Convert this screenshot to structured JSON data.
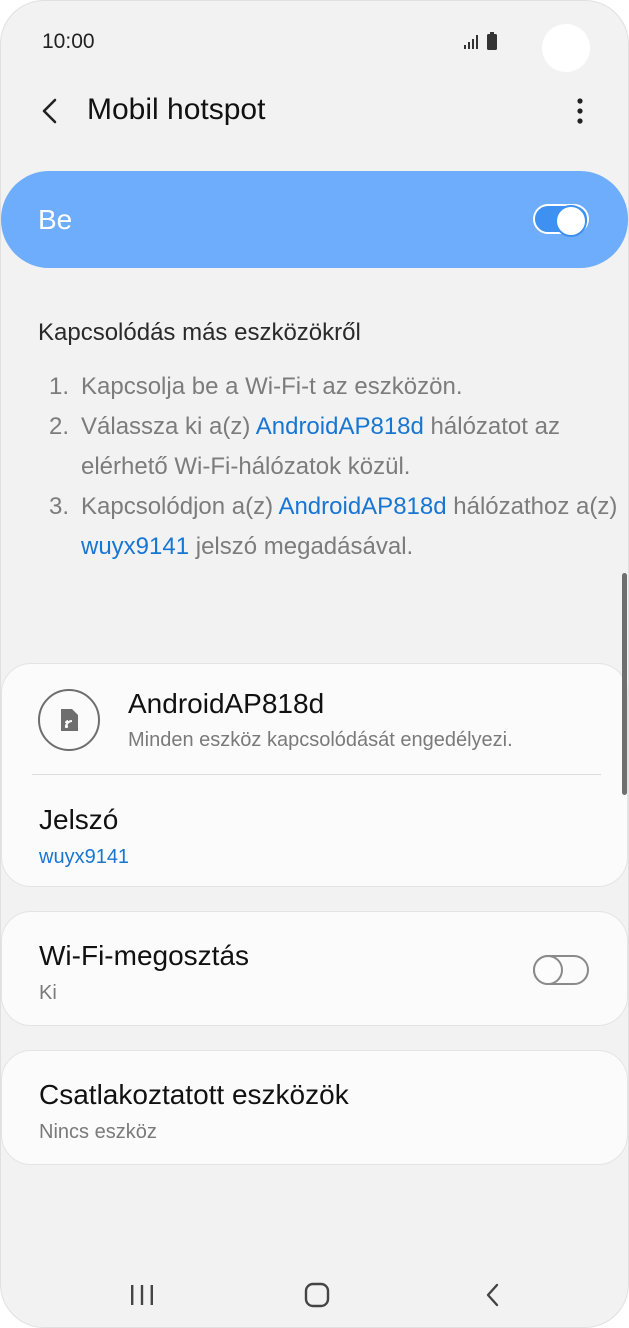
{
  "status_bar": {
    "time": "10:00"
  },
  "app_bar": {
    "title": "Mobil hotspot"
  },
  "master_switch": {
    "label": "Be",
    "state": "on",
    "accent_color": "#6eadfb"
  },
  "instructions": {
    "title": "Kapcsolódás más eszközökről",
    "steps": [
      {
        "number": "1.",
        "parts": [
          "Kapcsolja be a Wi-Fi-t az eszközön."
        ]
      },
      {
        "number": "2.",
        "parts": [
          "Válassza ki a(z) ",
          "AndroidAP818d",
          " hálózatot az elérhető Wi-Fi-hálózatok közül."
        ]
      },
      {
        "number": "3.",
        "parts": [
          "Kapcsolódjon a(z) ",
          "AndroidAP818d",
          " hálózathoz a(z) ",
          "wuyx9141",
          " jelszó megadásával."
        ]
      }
    ],
    "link_color": "#1776d3"
  },
  "network": {
    "icon": "hotspot-icon",
    "name": "AndroidAP818d",
    "description": "Minden eszköz kapcsolódását engedélyezi."
  },
  "password": {
    "title": "Jelszó",
    "value": "wuyx9141"
  },
  "wifi_sharing": {
    "title": "Wi-Fi-megosztás",
    "subtitle": "Ki",
    "state": "off"
  },
  "connected_devices": {
    "title": "Csatlakoztatott eszközök",
    "subtitle": "Nincs eszköz"
  },
  "nav_bar": {
    "icons": [
      "recents-icon",
      "home-icon",
      "back-icon"
    ]
  }
}
